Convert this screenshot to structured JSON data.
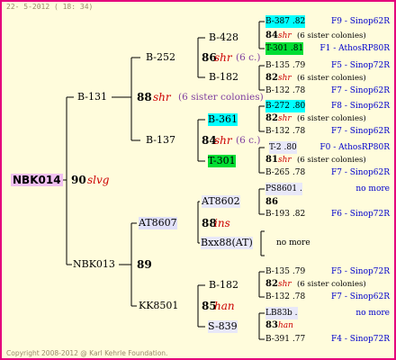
{
  "header": {
    "date": "22- 5-2012 ( 18: 34)"
  },
  "footer": {
    "copyright": "Copyright 2008-2012 @ Karl Kehrle Foundation."
  },
  "root": {
    "id": "NBK014",
    "year": "90",
    "breed": "slvg"
  },
  "gen1": {
    "dam": {
      "id": "B-131",
      "year": "88",
      "breed": "shr",
      "sisters": "(6 sister colonies)"
    },
    "sire": {
      "id": "NBK013",
      "year": "89"
    }
  },
  "gen2": {
    "b252": {
      "id": "B-252",
      "year": "86",
      "breed": "shr",
      "sisters": "(6 c.)"
    },
    "b137": {
      "id": "B-137",
      "year": "84",
      "breed": "shr",
      "sisters": "(6 c.)"
    },
    "at8607": {
      "id": "AT8607",
      "year": "88",
      "breed": "ins"
    },
    "kk8501": {
      "id": "KK8501",
      "year": "85",
      "breed": "han"
    }
  },
  "gen3": {
    "b428": "B-428",
    "b182a": "B-182",
    "b361": "B-361",
    "t301": "T-301",
    "at8602": "AT8602",
    "bxx88": "Bxx88(AT)",
    "b182b": "B-182",
    "s839": "S-839"
  },
  "gen4": [
    {
      "id": "B-387 .82",
      "ref": "F9 - Sinop62R"
    },
    {
      "year": "84",
      "breed": "shr",
      "sisters": "(6 sister colonies)"
    },
    {
      "id": "T-301 .81",
      "ref": "F1 - AthosRP80R"
    },
    {
      "id": "B-135 .79",
      "ref": "F5 - Sinop72R"
    },
    {
      "year": "82",
      "breed": "shr",
      "sisters": "(6 sister colonies)"
    },
    {
      "id": "B-132 .78",
      "ref": "F7 - Sinop62R"
    },
    {
      "id": "B-272 .80",
      "ref": "F8 - Sinop62R"
    },
    {
      "year": "82",
      "breed": "shr",
      "sisters": "(6 sister colonies)"
    },
    {
      "id": "B-132 .78",
      "ref": "F7 - Sinop62R"
    },
    {
      "id": "T-2 .80",
      "ref": "F0 - AthosRP80R"
    },
    {
      "year": "81",
      "breed": "shr",
      "sisters": "(6 sister colonies)"
    },
    {
      "id": "B-265 .78",
      "ref": "F7 - Sinop62R"
    },
    {
      "id": "PS8601 .",
      "ref": "no more"
    },
    {
      "year": "86"
    },
    {
      "id": "B-193 .82",
      "ref": "F6 - Sinop72R"
    },
    {
      "ref": "no more"
    },
    {
      "id": "B-135 .79",
      "ref": "F5 - Sinop72R"
    },
    {
      "year": "82",
      "breed": "shr",
      "sisters": "(6 sister colonies)"
    },
    {
      "id": "B-132 .78",
      "ref": "F7 - Sinop62R"
    },
    {
      "id": "LB83b .",
      "ref": "no more"
    },
    {
      "year": "83",
      "breed": "han"
    },
    {
      "id": "B-391 .77",
      "ref": "F4 - Sinop72R"
    }
  ]
}
